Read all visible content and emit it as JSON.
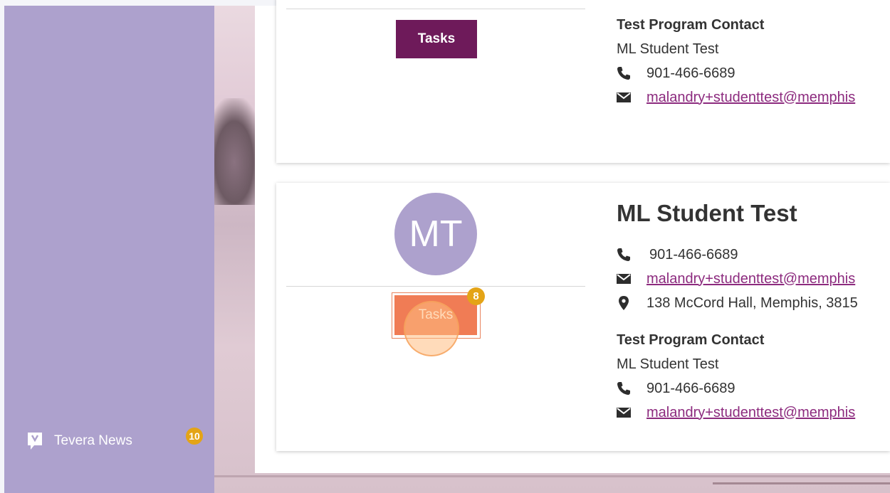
{
  "sidebar": {
    "news": {
      "label": "Tevera News",
      "badge": "10"
    }
  },
  "card1": {
    "tasks_label": "Tasks",
    "contact": {
      "heading": "Test Program Contact",
      "name": "ML Student Test",
      "phone": "901-466-6689",
      "email": "malandry+studenttest@memphis"
    }
  },
  "card2": {
    "avatar_initials": "MT",
    "tasks_label": "Tasks",
    "tasks_badge": "8",
    "name": "ML Student Test",
    "phone": "901-466-6689",
    "email": "malandry+studenttest@memphis",
    "address": "138 McCord Hall, Memphis, 3815",
    "contact": {
      "heading": "Test Program Contact",
      "name": "ML Student Test",
      "phone": "901-466-6689",
      "email": "malandry+studenttest@memphis"
    }
  },
  "colors": {
    "sidebar": "#ada1cd",
    "tasks_primary": "#6e1a5a",
    "tasks_highlight": "#f07c55",
    "badge": "#e4a417",
    "link": "#8c2a7e"
  }
}
